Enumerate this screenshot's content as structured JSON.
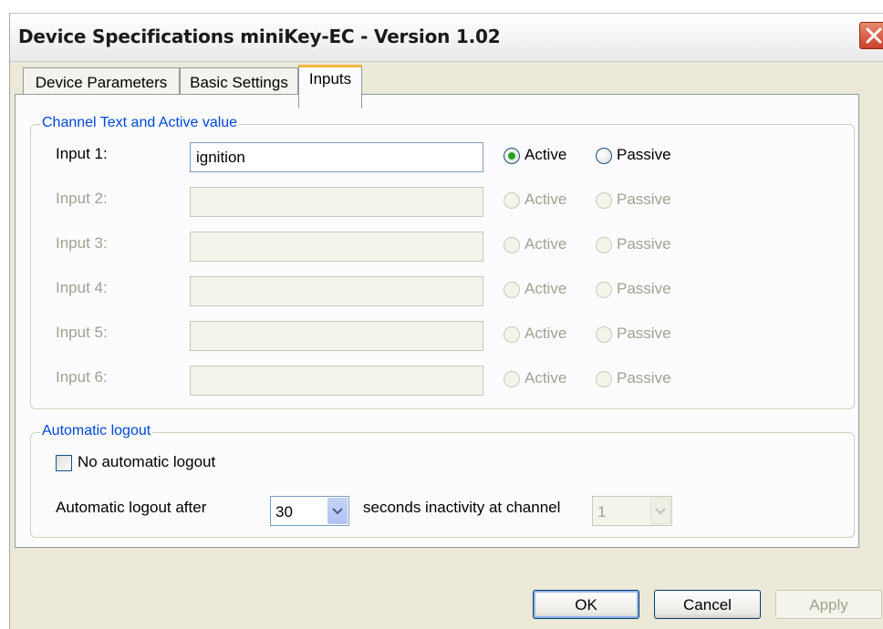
{
  "window": {
    "title": "Device Specifications miniKey-EC - Version 1.02"
  },
  "tabs": [
    {
      "label": "Device Parameters",
      "active": false
    },
    {
      "label": "Basic Settings",
      "active": false
    },
    {
      "label": "Inputs",
      "active": true
    }
  ],
  "channel_group": {
    "legend": "Channel Text and Active value",
    "inputs": [
      {
        "label": "Input 1:",
        "value": "ignition",
        "active_label": "Active",
        "passive_label": "Passive",
        "selected": "Active",
        "enabled": true
      },
      {
        "label": "Input 2:",
        "value": "",
        "active_label": "Active",
        "passive_label": "Passive",
        "selected": "",
        "enabled": false
      },
      {
        "label": "Input 3:",
        "value": "",
        "active_label": "Active",
        "passive_label": "Passive",
        "selected": "",
        "enabled": false
      },
      {
        "label": "Input 4:",
        "value": "",
        "active_label": "Active",
        "passive_label": "Passive",
        "selected": "",
        "enabled": false
      },
      {
        "label": "Input 5:",
        "value": "",
        "active_label": "Active",
        "passive_label": "Passive",
        "selected": "",
        "enabled": false
      },
      {
        "label": "Input 6:",
        "value": "",
        "active_label": "Active",
        "passive_label": "Passive",
        "selected": "",
        "enabled": false
      }
    ]
  },
  "logout_group": {
    "legend": "Automatic logout",
    "no_logout_label": "No automatic logout",
    "no_logout_checked": false,
    "after_label": "Automatic logout after",
    "seconds_value": "30",
    "seconds_label": "seconds inactivity at channel",
    "channel_value": "1"
  },
  "buttons": {
    "ok": "OK",
    "cancel": "Cancel",
    "apply": "Apply"
  },
  "colors": {
    "group_legend": "#0046d5",
    "active_tab_accent": "#f4b743",
    "close_button": "#c9402a"
  }
}
